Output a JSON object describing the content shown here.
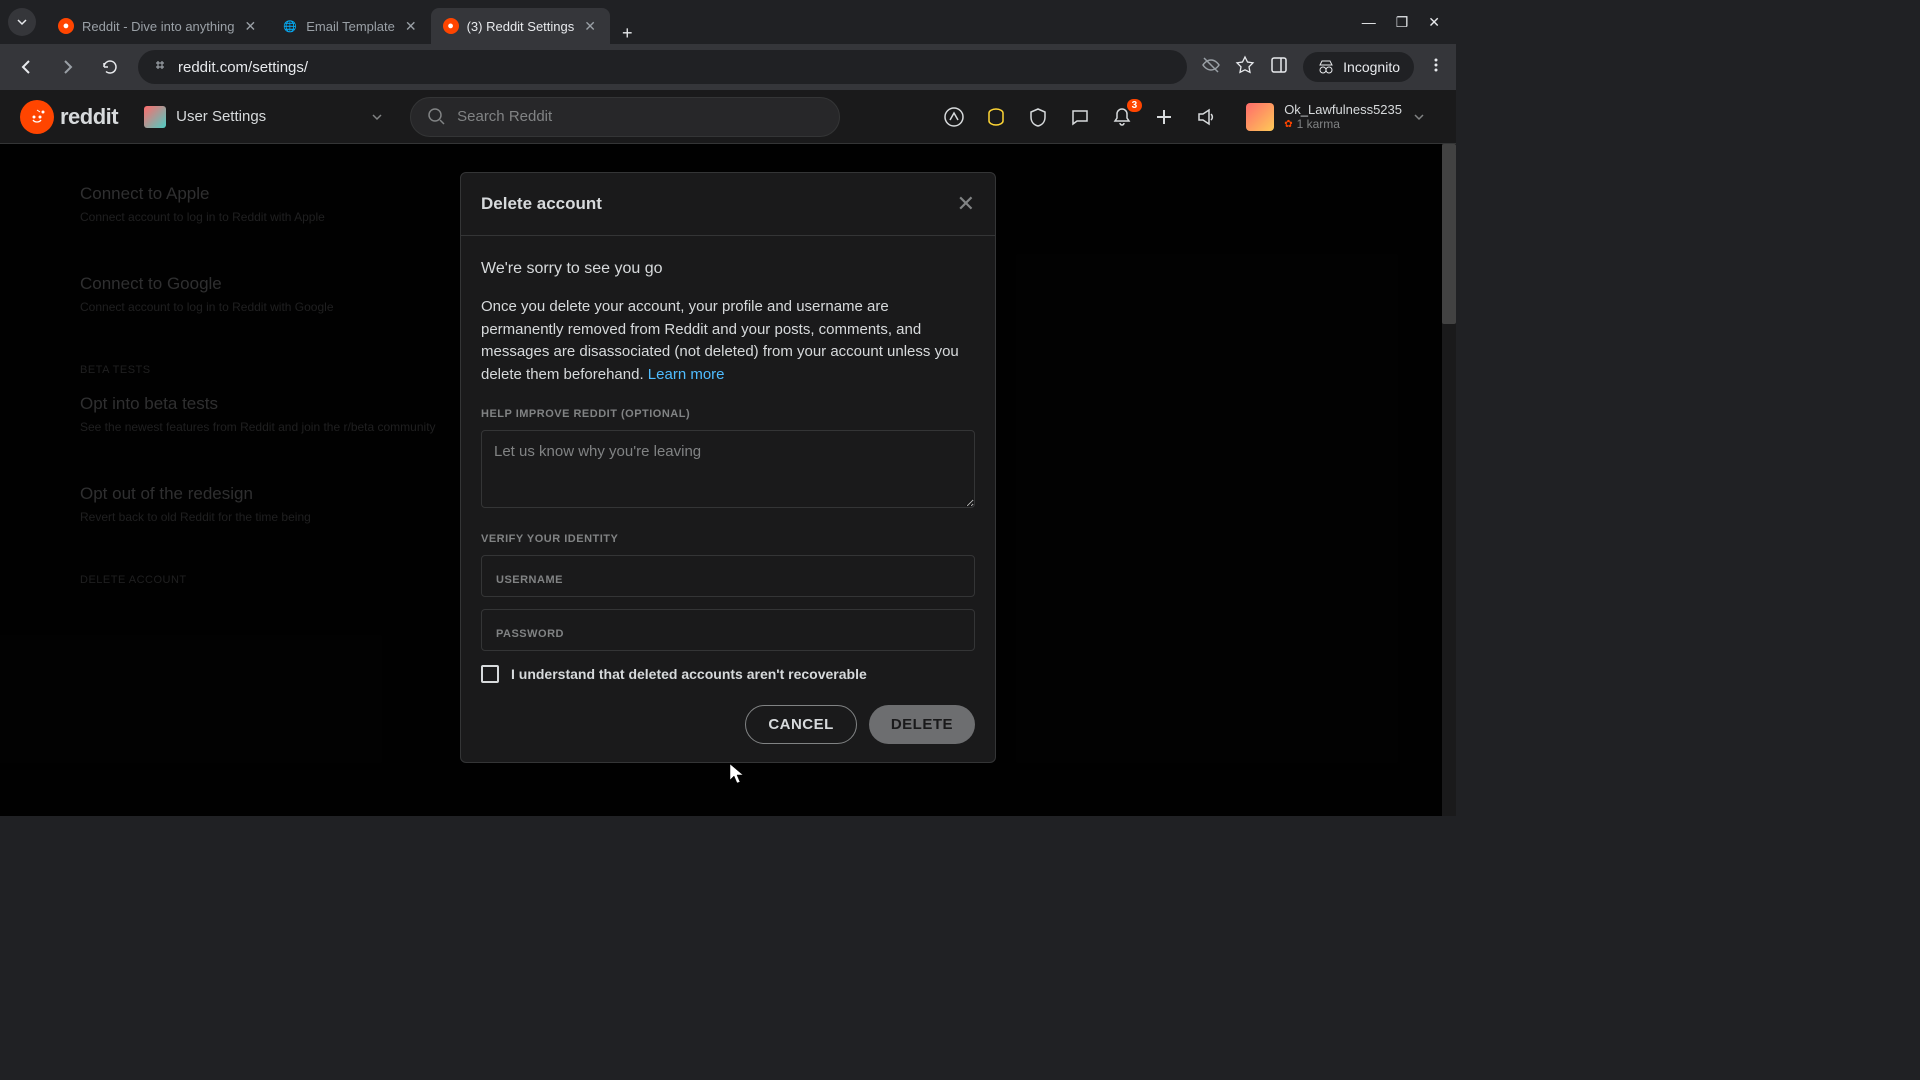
{
  "browser": {
    "tabs": [
      {
        "title": "Reddit - Dive into anything",
        "favicon": "reddit"
      },
      {
        "title": "Email Template",
        "favicon": "globe"
      },
      {
        "title": "(3) Reddit Settings",
        "favicon": "reddit",
        "active": true
      }
    ],
    "url": "reddit.com/settings/",
    "incognito_label": "Incognito"
  },
  "reddit_header": {
    "logo_text": "reddit",
    "nav_label": "User Settings",
    "search_placeholder": "Search Reddit",
    "notification_count": "3",
    "username": "Ok_Lawfulness5235",
    "karma": "1 karma"
  },
  "settings_bg": {
    "items": [
      {
        "title": "Connect to Apple",
        "sub": "Connect account to log in to Reddit with Apple"
      },
      {
        "title": "Connect to Google",
        "sub": "Connect account to log in to Reddit with Google"
      }
    ],
    "beta_label": "BETA TESTS",
    "beta_items": [
      {
        "title": "Opt into beta tests",
        "sub": "See the newest features from Reddit and join the r/beta community"
      },
      {
        "title": "Opt out of the redesign",
        "sub": "Revert back to old Reddit for the time being"
      }
    ],
    "delete_label": "DELETE ACCOUNT"
  },
  "modal": {
    "title": "Delete account",
    "sorry": "We're sorry to see you go",
    "explain": "Once you delete your account, your profile and username are permanently removed from Reddit and your posts, comments, and messages are disassociated (not deleted) from your account unless you delete them beforehand. ",
    "learn_more": "Learn more",
    "help_label": "HELP IMPROVE REDDIT (OPTIONAL)",
    "reason_placeholder": "Let us know why you're leaving",
    "verify_label": "VERIFY YOUR IDENTITY",
    "username_label": "USERNAME",
    "password_label": "PASSWORD",
    "checkbox_label": "I understand that deleted accounts aren't recoverable",
    "cancel": "CANCEL",
    "delete": "DELETE"
  }
}
